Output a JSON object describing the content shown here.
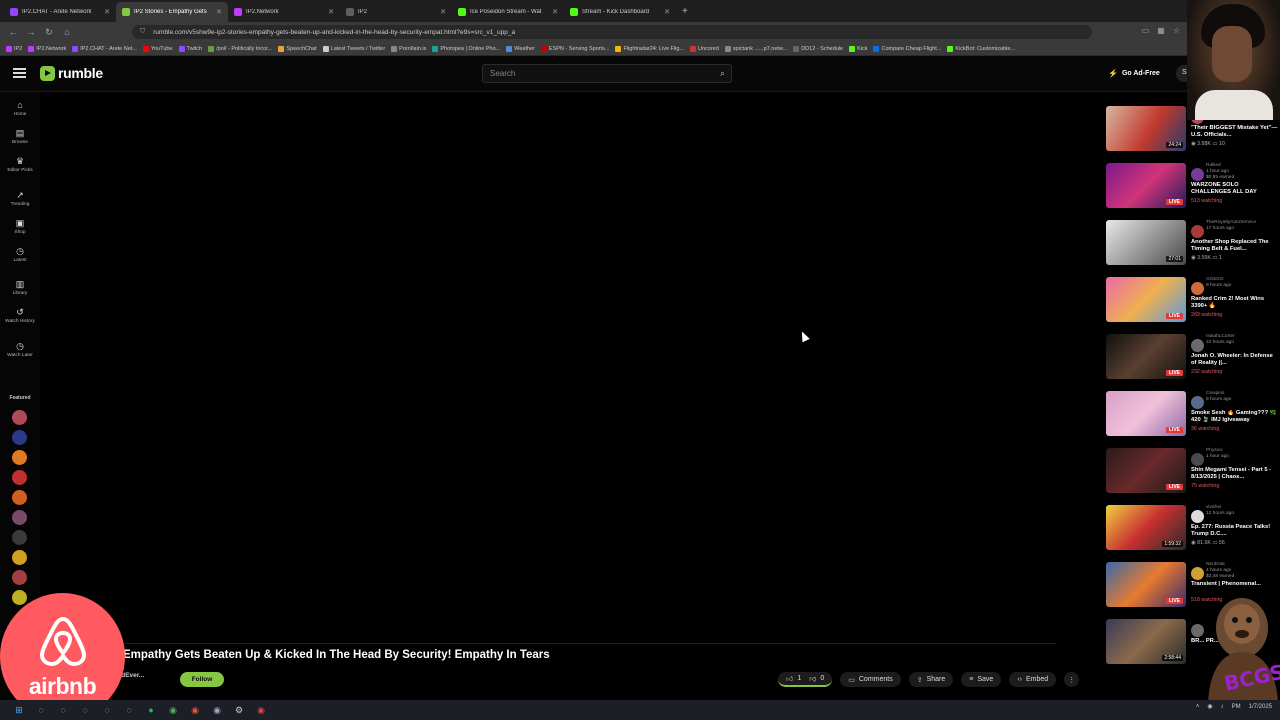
{
  "browser": {
    "tabs": [
      {
        "title": "IP2.CHAT - Arete Network",
        "color": "#9146ff",
        "active": false
      },
      {
        "title": "IP2 Stories - Empathy Gets",
        "color": "#85c742",
        "active": true
      },
      {
        "title": "IP2.Network",
        "color": "#c03aff",
        "active": false
      },
      {
        "title": "IP2",
        "color": "#5e5e5e",
        "active": false
      },
      {
        "title": "Ice Poseidon Stream - Wat",
        "color": "#53fc18",
        "active": false
      },
      {
        "title": "Stream - Kick Dashboard",
        "color": "#53fc18",
        "active": false
      }
    ],
    "new_tab": "+",
    "url": "rumble.com/v5shw9e-ip2-stories-empathy-gets-beaten-up-and-kicked-in-the-head-by-security-empat.html?e9s=src_v1_upp_a",
    "bookmarks": [
      {
        "label": "IP2",
        "color": "#c03aff"
      },
      {
        "label": "IP2.Network",
        "color": "#c03aff"
      },
      {
        "label": "IP2.CHAT - Arete Net...",
        "color": "#9146ff"
      },
      {
        "label": "YouTube",
        "color": "#ff0000"
      },
      {
        "label": "Twitch",
        "color": "#9146ff"
      },
      {
        "label": "/pol/ - Politically Incor...",
        "color": "#6b9a4a"
      },
      {
        "label": "SpeechChat",
        "color": "#e8a23a"
      },
      {
        "label": "Latest Tweets / Twitter",
        "color": "#cccccc"
      },
      {
        "label": "PornIlain.is",
        "color": "#888888"
      },
      {
        "label": "Photopea | Online Pho...",
        "color": "#18a497"
      },
      {
        "label": "Weather",
        "color": "#4a90d9"
      },
      {
        "label": "ESPN - Serving Sports...",
        "color": "#cc0000"
      },
      {
        "label": "Flightradar24: Live Flig...",
        "color": "#f5b800"
      },
      {
        "label": "Uncored",
        "color": "#cc3333"
      },
      {
        "label": "spictank ......p7.netw...",
        "color": "#888888"
      },
      {
        "label": "DD12 - Schedule",
        "color": "#666666"
      },
      {
        "label": "Kick",
        "color": "#53fc18"
      },
      {
        "label": "Compare Cheap Flight...",
        "color": "#0770e3"
      },
      {
        "label": "KickBot: Customizable...",
        "color": "#53fc18"
      }
    ]
  },
  "header": {
    "logo": "rumble",
    "search_placeholder": "Search",
    "ad_free": "Go Ad-Free",
    "sign_in": "Sig"
  },
  "sidebar": {
    "items": [
      {
        "label": "Home",
        "icon": "home-icon",
        "glyph": "⌂"
      },
      {
        "label": "Browse",
        "icon": "browse-icon",
        "glyph": "▤"
      },
      {
        "label": "Editor Picks",
        "icon": "editor-picks-icon",
        "glyph": "♛"
      },
      {
        "label": "Trending",
        "icon": "trending-icon",
        "glyph": "↗"
      },
      {
        "label": "Shop",
        "icon": "shop-icon",
        "glyph": "▣"
      },
      {
        "label": "Latest",
        "icon": "latest-icon",
        "glyph": "◷"
      },
      {
        "label": "Library",
        "icon": "library-icon",
        "glyph": "▥"
      },
      {
        "label": "Watch History",
        "icon": "history-icon",
        "glyph": "↺"
      },
      {
        "label": "Watch Later",
        "icon": "watch-later-icon",
        "glyph": "◷"
      }
    ],
    "featured_label": "Featured",
    "featured_colors": [
      "#b04a5a",
      "#2a3a8a",
      "#e07a20",
      "#c03030",
      "#d06020",
      "#7a4a6a",
      "#3a3a3a",
      "#d0a020",
      "#a04040",
      "#c0b020"
    ]
  },
  "video": {
    "title": "Empathy Gets Beaten Up & Kicked In The Head By Security! Empathy In Tears",
    "channel": "kedEver...",
    "follow": "Follow",
    "likes": "1",
    "dislikes": "0",
    "comments": "Comments",
    "share": "Share",
    "save": "Save",
    "embed": "Embed"
  },
  "overlay": {
    "sponsor": "airbnb"
  },
  "recommendations": [
    {
      "channel": "",
      "time": "3 hours ago",
      "title": "\"Their BIGGEST Mistake Yet\"—U.S. Officials...",
      "stat": "3.88K",
      "comments": "10",
      "duration": "24:24",
      "live": false,
      "thumb": "linear-gradient(120deg,#d8b7a0 0%,#c23a2e 55%,#2a3a6a 100%)",
      "avatar": "#b04a5a"
    },
    {
      "channel": "Rallied",
      "time": "1 hour ago",
      "earned": "$0.55 earned",
      "title": "WARZONE SOLO CHALLENGES ALL DAY",
      "stat": "513 watching",
      "live": true,
      "thumb": "linear-gradient(135deg,#7a1a8a 0%,#d0347a 50%,#2a1a5a 100%)",
      "avatar": "#7a3a9a"
    },
    {
      "channel": "TheRoyaltyAutoService",
      "time": "17 hours ago",
      "title": "Another Shop Replaced The Timing Belt & Fuel...",
      "stat": "3.55K",
      "comments": "1",
      "duration": "27:01",
      "live": false,
      "thumb": "linear-gradient(135deg,#e8e8e8 0%,#9a9a9a 50%,#4a4a4a 100%)",
      "avatar": "#aa3a3a"
    },
    {
      "channel": "GritsGG",
      "time": "9 hours ago",
      "title": "Ranked Crim 2! Most Wins 3390+ 🔥",
      "stat": "269 watching",
      "live": true,
      "thumb": "linear-gradient(135deg,#e86aa8 0%,#f0b050 50%,#5a9ad8 100%)",
      "avatar": "#d06a3a"
    },
    {
      "channel": "IsaiahLCarter",
      "time": "22 hours ago",
      "title": "Jonah O. Wheeler: In Defense of Reality ||...",
      "stat": "232 watching",
      "live": true,
      "thumb": "linear-gradient(135deg,#111 0%,#5a4030 50%,#111 100%)",
      "avatar": "#6a6a6a"
    },
    {
      "channel": "Cewpins",
      "time": "9 hours ago",
      "title": "Smoke Sesh 🔥 Gaming??? 🌿 420 🍃 IMJ Igiveaway",
      "stat": "36 watching",
      "live": true,
      "thumb": "linear-gradient(135deg,#d8a0c8 0%,#f0c0d8 50%,#8a6aa8 100%)",
      "avatar": "#5a6a8a"
    },
    {
      "channel": "Physicx",
      "time": "1 hour ago",
      "title": "Shin Megami Tensei - Part 5 - 8/13/2025 | Chaos...",
      "stat": "75 watching",
      "live": true,
      "thumb": "linear-gradient(135deg,#2a1a1a 0%,#6a2a2a 50%,#1a1a1a 100%)",
      "avatar": "#4a4a4a"
    },
    {
      "channel": "vivafrei",
      "time": "12 hours ago",
      "title": "Ep. 277: Russia Peace Talks! Trump D.C....",
      "stat": "81.6K",
      "comments": "56",
      "duration": "1:59:32",
      "live": false,
      "thumb": "linear-gradient(135deg,#f0d040 0%,#c83030 50%,#2a2a2a 100%)",
      "avatar": "#dddddd"
    },
    {
      "channel": "Nerdrotic",
      "time": "4 hours ago",
      "earned": "$3.48 earned",
      "title": "Transient | Phenomenal...",
      "stat": "518 watching",
      "live": true,
      "thumb": "linear-gradient(135deg,#3a6aa8 0%,#e87a30 50%,#3a2a6a 100%)",
      "avatar": "#d0a030"
    },
    {
      "channel": "",
      "time": "",
      "title": "BR... PR...",
      "stat": "",
      "duration": "2:58:44",
      "live": false,
      "thumb": "linear-gradient(135deg,#3a3a5a 0%,#8a6a4a 50%,#2a2a2a 100%)",
      "avatar": "#6a6a6a"
    }
  ],
  "taskbar": {
    "time": "PM",
    "date": "1/7/2025"
  }
}
